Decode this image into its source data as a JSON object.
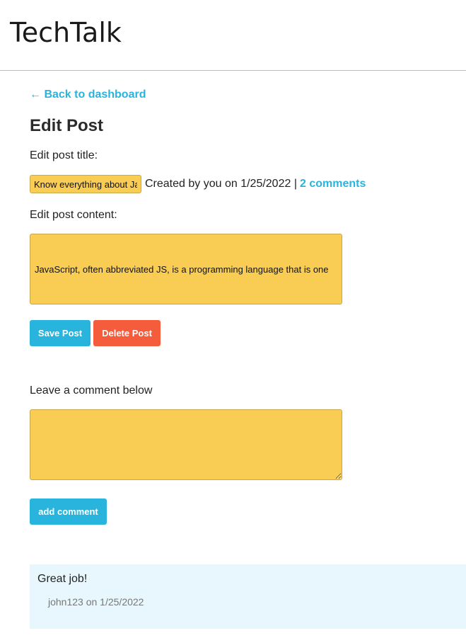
{
  "header": {
    "logo": "TechTalk"
  },
  "nav": {
    "back_link": "← Back to dashboard"
  },
  "page": {
    "title": "Edit Post"
  },
  "post": {
    "title_label": "Edit post title:",
    "title_value": "Know everything about JavaScript",
    "meta_text": "Created by you on 1/25/2022 |",
    "comments_link": "2 comments",
    "content_label": "Edit post content:",
    "content_value": "JavaScript, often abbreviated JS, is a programming language that is one",
    "save_button": "Save Post",
    "delete_button": "Delete Post"
  },
  "comment_form": {
    "label": "Leave a comment below",
    "value": "",
    "submit_button": "add comment"
  },
  "comments": [
    {
      "text": "Great job!",
      "meta": "john123 on 1/25/2022"
    }
  ],
  "colors": {
    "accent": "#28b4dc",
    "danger": "#f55c3b",
    "field": "#f9cd53",
    "comment_bg": "#e8f7fd"
  }
}
